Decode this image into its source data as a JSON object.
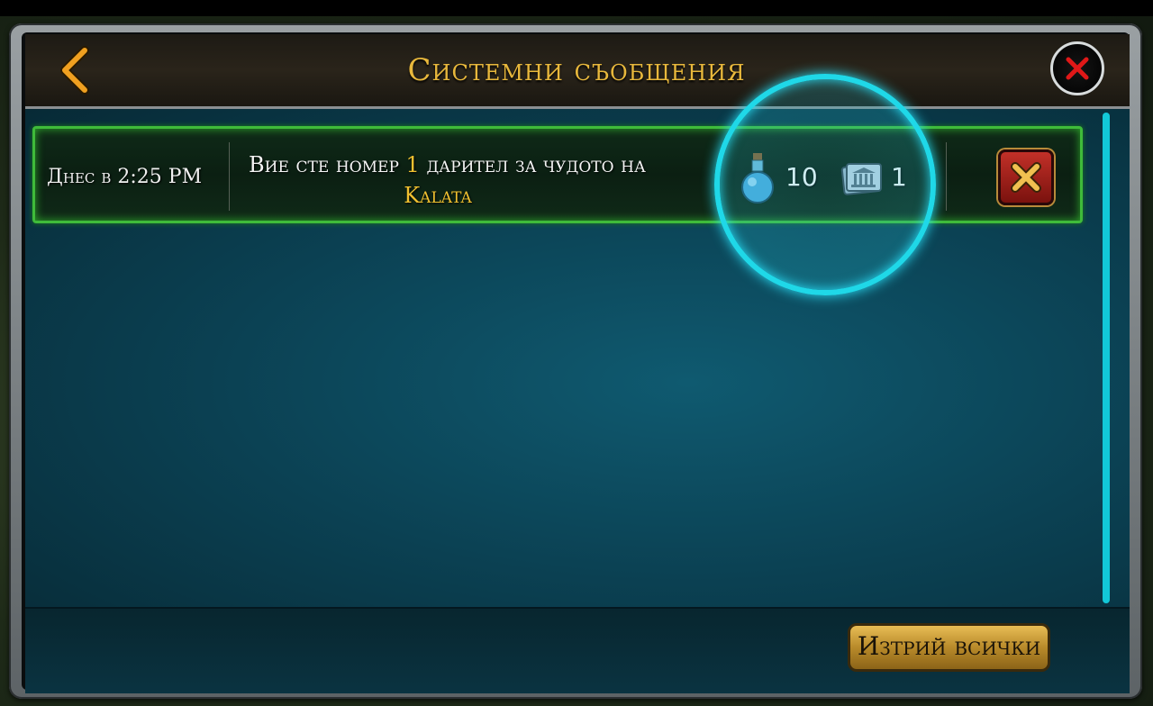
{
  "header": {
    "title": "Системни съобщения"
  },
  "messages": [
    {
      "date": "Днес в 2:25 PM",
      "text_before": "Вие сте номер",
      "rank": "1",
      "text_after": "дарител за чудото на",
      "wonder": "Kalata",
      "rewards": [
        {
          "icon": "potion-icon",
          "value": "10"
        },
        {
          "icon": "wonder-card-icon",
          "value": "1"
        }
      ]
    }
  ],
  "footer": {
    "delete_all_label": "Изтрий всички"
  },
  "colors": {
    "accent_gold": "#e8b83c",
    "highlight_cyan": "#1fd8e8",
    "row_border_green": "#3fbb3a"
  }
}
